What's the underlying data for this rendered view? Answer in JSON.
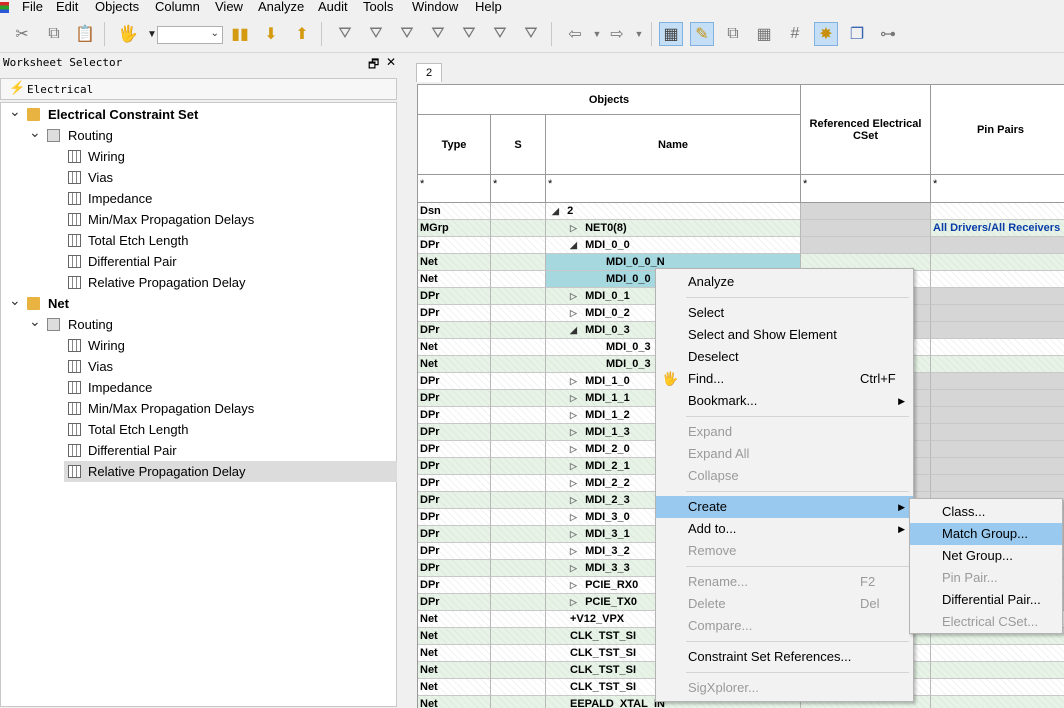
{
  "menubar": [
    "File",
    "Edit",
    "Objects",
    "Column",
    "View",
    "Analyze",
    "Audit",
    "Tools",
    "Window",
    "Help"
  ],
  "toolbar": {
    "combo_value": ""
  },
  "worksheet_selector": {
    "title": "Worksheet Selector",
    "restore_glyph": "🗗",
    "close_glyph": "✕",
    "tab_label": "Electrical",
    "tree": [
      {
        "label": "Electrical Constraint Set",
        "level": 0,
        "icon": "folder-icon",
        "expanded": true,
        "bold": true
      },
      {
        "label": "Routing",
        "level": 1,
        "icon": "worksheet-group-icon",
        "expanded": true
      },
      {
        "label": "Wiring",
        "level": 2,
        "icon": "worksheet-icon"
      },
      {
        "label": "Vias",
        "level": 2,
        "icon": "worksheet-icon"
      },
      {
        "label": "Impedance",
        "level": 2,
        "icon": "worksheet-icon"
      },
      {
        "label": "Min/Max Propagation Delays",
        "level": 2,
        "icon": "worksheet-icon"
      },
      {
        "label": "Total Etch Length",
        "level": 2,
        "icon": "worksheet-icon"
      },
      {
        "label": "Differential Pair",
        "level": 2,
        "icon": "worksheet-icon"
      },
      {
        "label": "Relative Propagation Delay",
        "level": 2,
        "icon": "worksheet-icon"
      },
      {
        "label": "Net",
        "level": 0,
        "icon": "folder-icon",
        "expanded": true,
        "bold": true
      },
      {
        "label": "Routing",
        "level": 1,
        "icon": "worksheet-group-icon",
        "expanded": true
      },
      {
        "label": "Wiring",
        "level": 2,
        "icon": "worksheet-icon"
      },
      {
        "label": "Vias",
        "level": 2,
        "icon": "worksheet-icon"
      },
      {
        "label": "Impedance",
        "level": 2,
        "icon": "worksheet-icon"
      },
      {
        "label": "Min/Max Propagation Delays",
        "level": 2,
        "icon": "worksheet-icon"
      },
      {
        "label": "Total Etch Length",
        "level": 2,
        "icon": "worksheet-icon"
      },
      {
        "label": "Differential Pair",
        "level": 2,
        "icon": "worksheet-icon"
      },
      {
        "label": "Relative Propagation Delay",
        "level": 2,
        "icon": "worksheet-icon",
        "selected": true
      }
    ]
  },
  "worksheet": {
    "tab": "2",
    "header_objects": "Objects",
    "columns": {
      "type": "Type",
      "s": "S",
      "name": "Name",
      "ref": "Referenced Electrical CSet",
      "pinpairs": "Pin Pairs"
    },
    "filters": {
      "type": "*",
      "s": "*",
      "name": "*",
      "ref": "*",
      "pinpairs": "*"
    },
    "rows": [
      {
        "type": "Dsn",
        "name": "2",
        "indent": 0,
        "tri": "open"
      },
      {
        "type": "MGrp",
        "name": "NET0(8)",
        "indent": 1,
        "tri": "closed",
        "pin": "All Drivers/All Receivers"
      },
      {
        "type": "DPr",
        "name": "MDI_0_0",
        "indent": 1,
        "tri": "open"
      },
      {
        "type": "Net",
        "name": "MDI_0_0_N",
        "indent": 2,
        "tri": "",
        "sel": true
      },
      {
        "type": "Net",
        "name": "MDI_0_0",
        "indent": 2,
        "tri": "",
        "sel": true
      },
      {
        "type": "DPr",
        "name": "MDI_0_1",
        "indent": 1,
        "tri": "closed"
      },
      {
        "type": "DPr",
        "name": "MDI_0_2",
        "indent": 1,
        "tri": "closed"
      },
      {
        "type": "DPr",
        "name": "MDI_0_3",
        "indent": 1,
        "tri": "open"
      },
      {
        "type": "Net",
        "name": "MDI_0_3",
        "indent": 2,
        "tri": ""
      },
      {
        "type": "Net",
        "name": "MDI_0_3",
        "indent": 2,
        "tri": ""
      },
      {
        "type": "DPr",
        "name": "MDI_1_0",
        "indent": 1,
        "tri": "closed"
      },
      {
        "type": "DPr",
        "name": "MDI_1_1",
        "indent": 1,
        "tri": "closed"
      },
      {
        "type": "DPr",
        "name": "MDI_1_2",
        "indent": 1,
        "tri": "closed"
      },
      {
        "type": "DPr",
        "name": "MDI_1_3",
        "indent": 1,
        "tri": "closed"
      },
      {
        "type": "DPr",
        "name": "MDI_2_0",
        "indent": 1,
        "tri": "closed"
      },
      {
        "type": "DPr",
        "name": "MDI_2_1",
        "indent": 1,
        "tri": "closed"
      },
      {
        "type": "DPr",
        "name": "MDI_2_2",
        "indent": 1,
        "tri": "closed"
      },
      {
        "type": "DPr",
        "name": "MDI_2_3",
        "indent": 1,
        "tri": "closed"
      },
      {
        "type": "DPr",
        "name": "MDI_3_0",
        "indent": 1,
        "tri": "closed"
      },
      {
        "type": "DPr",
        "name": "MDI_3_1",
        "indent": 1,
        "tri": "closed"
      },
      {
        "type": "DPr",
        "name": "MDI_3_2",
        "indent": 1,
        "tri": "closed"
      },
      {
        "type": "DPr",
        "name": "MDI_3_3",
        "indent": 1,
        "tri": "closed"
      },
      {
        "type": "DPr",
        "name": "PCIE_RX0",
        "indent": 1,
        "tri": "closed"
      },
      {
        "type": "DPr",
        "name": "PCIE_TX0",
        "indent": 1,
        "tri": "closed"
      },
      {
        "type": "Net",
        "name": "+V12_VPX",
        "indent": 1,
        "tri": ""
      },
      {
        "type": "Net",
        "name": "CLK_TST_SI",
        "indent": 1,
        "tri": ""
      },
      {
        "type": "Net",
        "name": "CLK_TST_SI",
        "indent": 1,
        "tri": ""
      },
      {
        "type": "Net",
        "name": "CLK_TST_SI",
        "indent": 1,
        "tri": ""
      },
      {
        "type": "Net",
        "name": "CLK_TST_SI",
        "indent": 1,
        "tri": ""
      },
      {
        "type": "Net",
        "name": "EEPALD_XTAL_IN",
        "indent": 1,
        "tri": ""
      }
    ]
  },
  "context_menu": {
    "items": [
      {
        "label": "Analyze"
      },
      {
        "sep": true
      },
      {
        "label": "Select"
      },
      {
        "label": "Select and Show Element"
      },
      {
        "label": "Deselect"
      },
      {
        "label": "Find...",
        "shortcut": "Ctrl+F",
        "icon": "find-icon"
      },
      {
        "label": "Bookmark...",
        "submenu": true
      },
      {
        "sep": true
      },
      {
        "label": "Expand",
        "disabled": true
      },
      {
        "label": "Expand All",
        "disabled": true
      },
      {
        "label": "Collapse",
        "disabled": true
      },
      {
        "sep": true
      },
      {
        "label": "Create",
        "submenu": true,
        "highlighted": true
      },
      {
        "label": "Add to...",
        "submenu": true
      },
      {
        "label": "Remove",
        "disabled": true
      },
      {
        "sep": true
      },
      {
        "label": "Rename...",
        "shortcut": "F2",
        "disabled": true
      },
      {
        "label": "Delete",
        "shortcut": "Del",
        "disabled": true
      },
      {
        "label": "Compare...",
        "disabled": true
      },
      {
        "sep": true
      },
      {
        "label": "Constraint Set References..."
      },
      {
        "sep": true
      },
      {
        "label": "SigXplorer...",
        "disabled": true
      }
    ]
  },
  "submenu": {
    "items": [
      {
        "label": "Class..."
      },
      {
        "label": "Match Group...",
        "highlighted": true
      },
      {
        "label": "Net Group..."
      },
      {
        "label": "Pin Pair...",
        "disabled": true
      },
      {
        "label": "Differential Pair..."
      },
      {
        "label": "Electrical CSet...",
        "disabled": true
      }
    ]
  },
  "colors": {
    "accent": "#99c9ef",
    "selected_cell": "#a6d8e0",
    "folder": "#e9b341",
    "link": "#0a3ca8"
  }
}
